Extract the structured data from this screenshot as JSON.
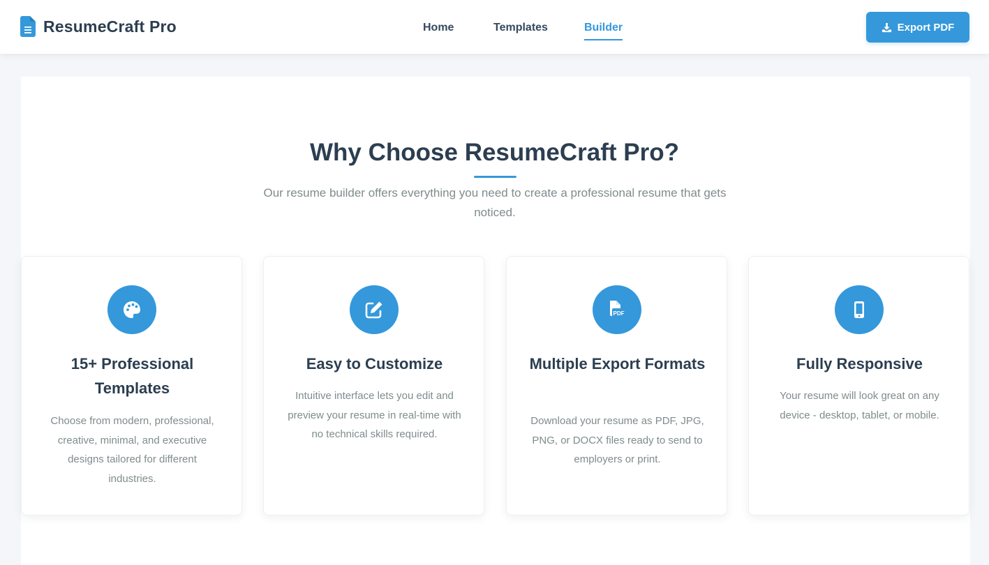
{
  "brand": {
    "name": "ResumeCraft Pro",
    "icon": "file-document-icon"
  },
  "nav": {
    "items": [
      {
        "label": "Home",
        "active": false
      },
      {
        "label": "Templates",
        "active": false
      },
      {
        "label": "Builder",
        "active": true
      }
    ]
  },
  "header": {
    "export_label": "Export PDF",
    "export_icon": "download-icon"
  },
  "colors": {
    "accent": "#3498db",
    "heading": "#2c3e50",
    "muted": "#7f8c8d",
    "page_background": "#f4f6fa"
  },
  "features": {
    "title": "Why Choose ResumeCraft Pro?",
    "subtitle": "Our resume builder offers everything you need to create a professional resume that gets noticed.",
    "cards": [
      {
        "icon": "palette-icon",
        "title": "15+ Professional Templates",
        "description": "Choose from modern, professional, creative, minimal, and executive designs tailored for different industries."
      },
      {
        "icon": "edit-icon",
        "title": "Easy to Customize",
        "description": "Intuitive interface lets you edit and preview your resume in real-time with no technical skills required."
      },
      {
        "icon": "pdf-file-icon",
        "title": "Multiple Export Formats",
        "description": "Download your resume as PDF, JPG, PNG, or DOCX files ready to send to employers or print."
      },
      {
        "icon": "mobile-icon",
        "title": "Fully Responsive",
        "description": "Your resume will look great on any device - desktop, tablet, or mobile."
      }
    ]
  }
}
